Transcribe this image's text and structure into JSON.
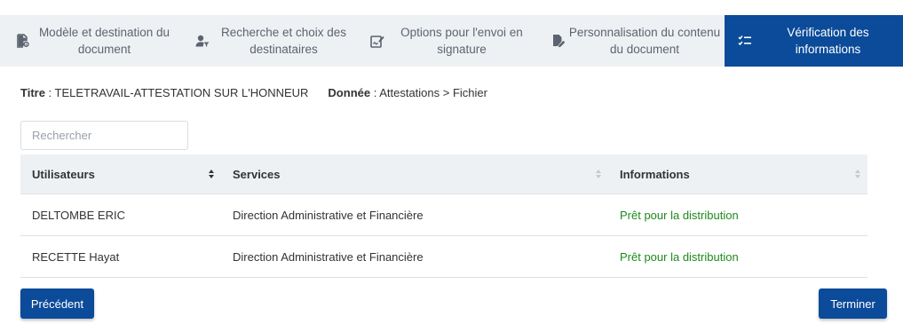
{
  "stepper": {
    "steps": [
      {
        "label": "Modèle et destination du document",
        "icon": "document-settings-icon"
      },
      {
        "label": "Recherche et choix des destinataires",
        "icon": "user-filter-icon"
      },
      {
        "label": "Options pour l'envoi en signature",
        "icon": "signature-icon"
      },
      {
        "label": "Personnalisation du contenu du document",
        "icon": "document-edit-icon"
      },
      {
        "label": "Vérification des informations",
        "icon": "checklist-icon",
        "active": true
      }
    ]
  },
  "info": {
    "title_label": "Titre",
    "title_value": "TELETRAVAIL-ATTESTATION SUR L'HONNEUR",
    "data_label": "Donnée",
    "data_value": "Attestations > Fichier"
  },
  "search": {
    "placeholder": "Rechercher",
    "value": ""
  },
  "table": {
    "columns": [
      "Utilisateurs",
      "Services",
      "Informations"
    ],
    "sorted_column": "Utilisateurs",
    "rows": [
      {
        "user": "DELTOMBE ERIC",
        "service": "Direction Administrative et Financière",
        "info": "Prêt pour la distribution"
      },
      {
        "user": "RECETTE Hayat",
        "service": "Direction Administrative et Financière",
        "info": "Prêt pour la distribution"
      }
    ]
  },
  "actions": {
    "previous_label": "Précédent",
    "finish_label": "Terminer"
  },
  "colors": {
    "primary": "#0b4b99",
    "stepper_bg": "#eef1f4",
    "status_ok": "#1d8a1d",
    "text": "#333333"
  }
}
